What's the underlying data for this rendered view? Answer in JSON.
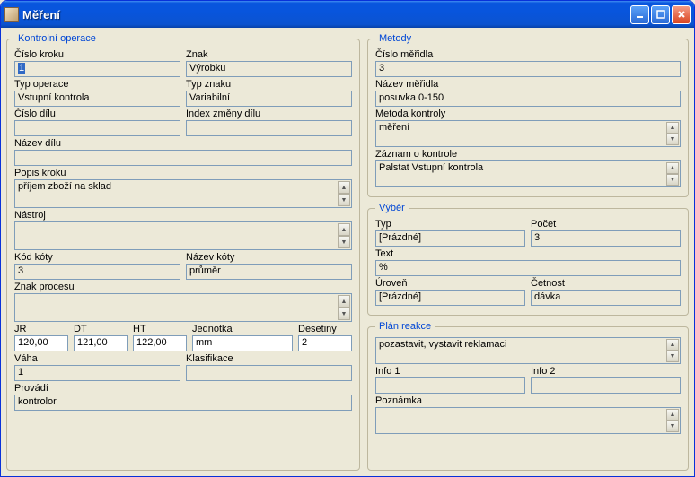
{
  "window": {
    "title": "Měření"
  },
  "kontrolni": {
    "legend": "Kontrolní operace",
    "cislo_kroku_label": "Číslo kroku",
    "cislo_kroku": "1",
    "znak_label": "Znak",
    "znak": "Výrobku",
    "typ_operace_label": "Typ operace",
    "typ_operace": "Vstupní kontrola",
    "typ_znaku_label": "Typ znaku",
    "typ_znaku": "Variabilní",
    "cislo_dilu_label": "Číslo dílu",
    "cislo_dilu": "",
    "index_zmeny_label": "Index změny dílu",
    "index_zmeny": "",
    "nazev_dilu_label": "Název dílu",
    "nazev_dilu": "",
    "popis_kroku_label": "Popis kroku",
    "popis_kroku": "příjem zboží na sklad",
    "nastroj_label": "Nástroj",
    "nastroj": "",
    "kod_koty_label": "Kód kóty",
    "kod_koty": "3",
    "nazev_koty_label": "Název kóty",
    "nazev_koty": "průměr",
    "znak_procesu_label": "Znak procesu",
    "znak_procesu": "",
    "jr_label": "JR",
    "jr": "120,00",
    "dt_label": "DT",
    "dt": "121,00",
    "ht_label": "HT",
    "ht": "122,00",
    "jednotka_label": "Jednotka",
    "jednotka": "mm",
    "desetiny_label": "Desetiny",
    "desetiny": "2",
    "vaha_label": "Váha",
    "vaha": "1",
    "klasifikace_label": "Klasifikace",
    "klasifikace": "",
    "provadi_label": "Provádí",
    "provadi": "kontrolor"
  },
  "metody": {
    "legend": "Metody",
    "cislo_meridla_label": "Číslo měřidla",
    "cislo_meridla": "3",
    "nazev_meridla_label": "Název měřidla",
    "nazev_meridla": "posuvka 0-150",
    "metoda_kontroly_label": "Metoda kontroly",
    "metoda_kontroly": "měření",
    "zaznam_label": "Záznam o kontrole",
    "zaznam": "Palstat Vstupní kontrola"
  },
  "vyber": {
    "legend": "Výběr",
    "typ_label": "Typ",
    "typ": "[Prázdné]",
    "pocet_label": "Počet",
    "pocet": "3",
    "text_label": "Text",
    "text": "%",
    "uroven_label": "Úroveň",
    "uroven": "[Prázdné]",
    "cetnost_label": "Četnost",
    "cetnost": "dávka"
  },
  "plan": {
    "legend": "Plán reakce",
    "plan_reakce": "pozastavit, vystavit reklamaci",
    "info1_label": "Info 1",
    "info1": "",
    "info2_label": "Info 2",
    "info2": "",
    "poznamka_label": "Poznámka",
    "poznamka": ""
  }
}
